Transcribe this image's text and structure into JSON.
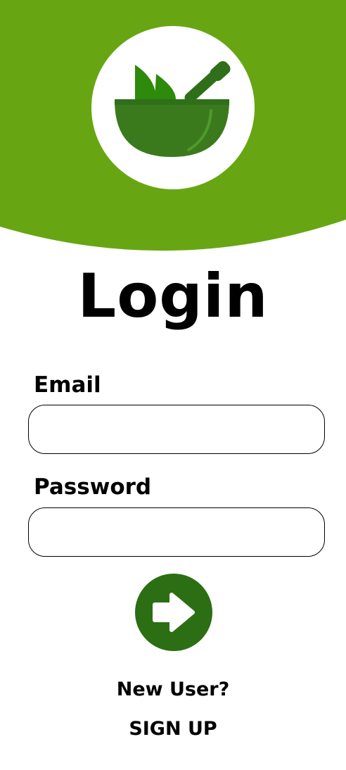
{
  "header": {
    "background_color": "#67a612",
    "logo_icon": "mortar-and-pestle-icon"
  },
  "title": "Login",
  "form": {
    "email_label": "Email",
    "email_value": "",
    "password_label": "Password",
    "password_value": "",
    "submit_icon": "arrow-right-icon",
    "submit_color": "#2c6e14"
  },
  "footer": {
    "new_user_text": "New User?",
    "signup_label": "SIGN UP"
  }
}
